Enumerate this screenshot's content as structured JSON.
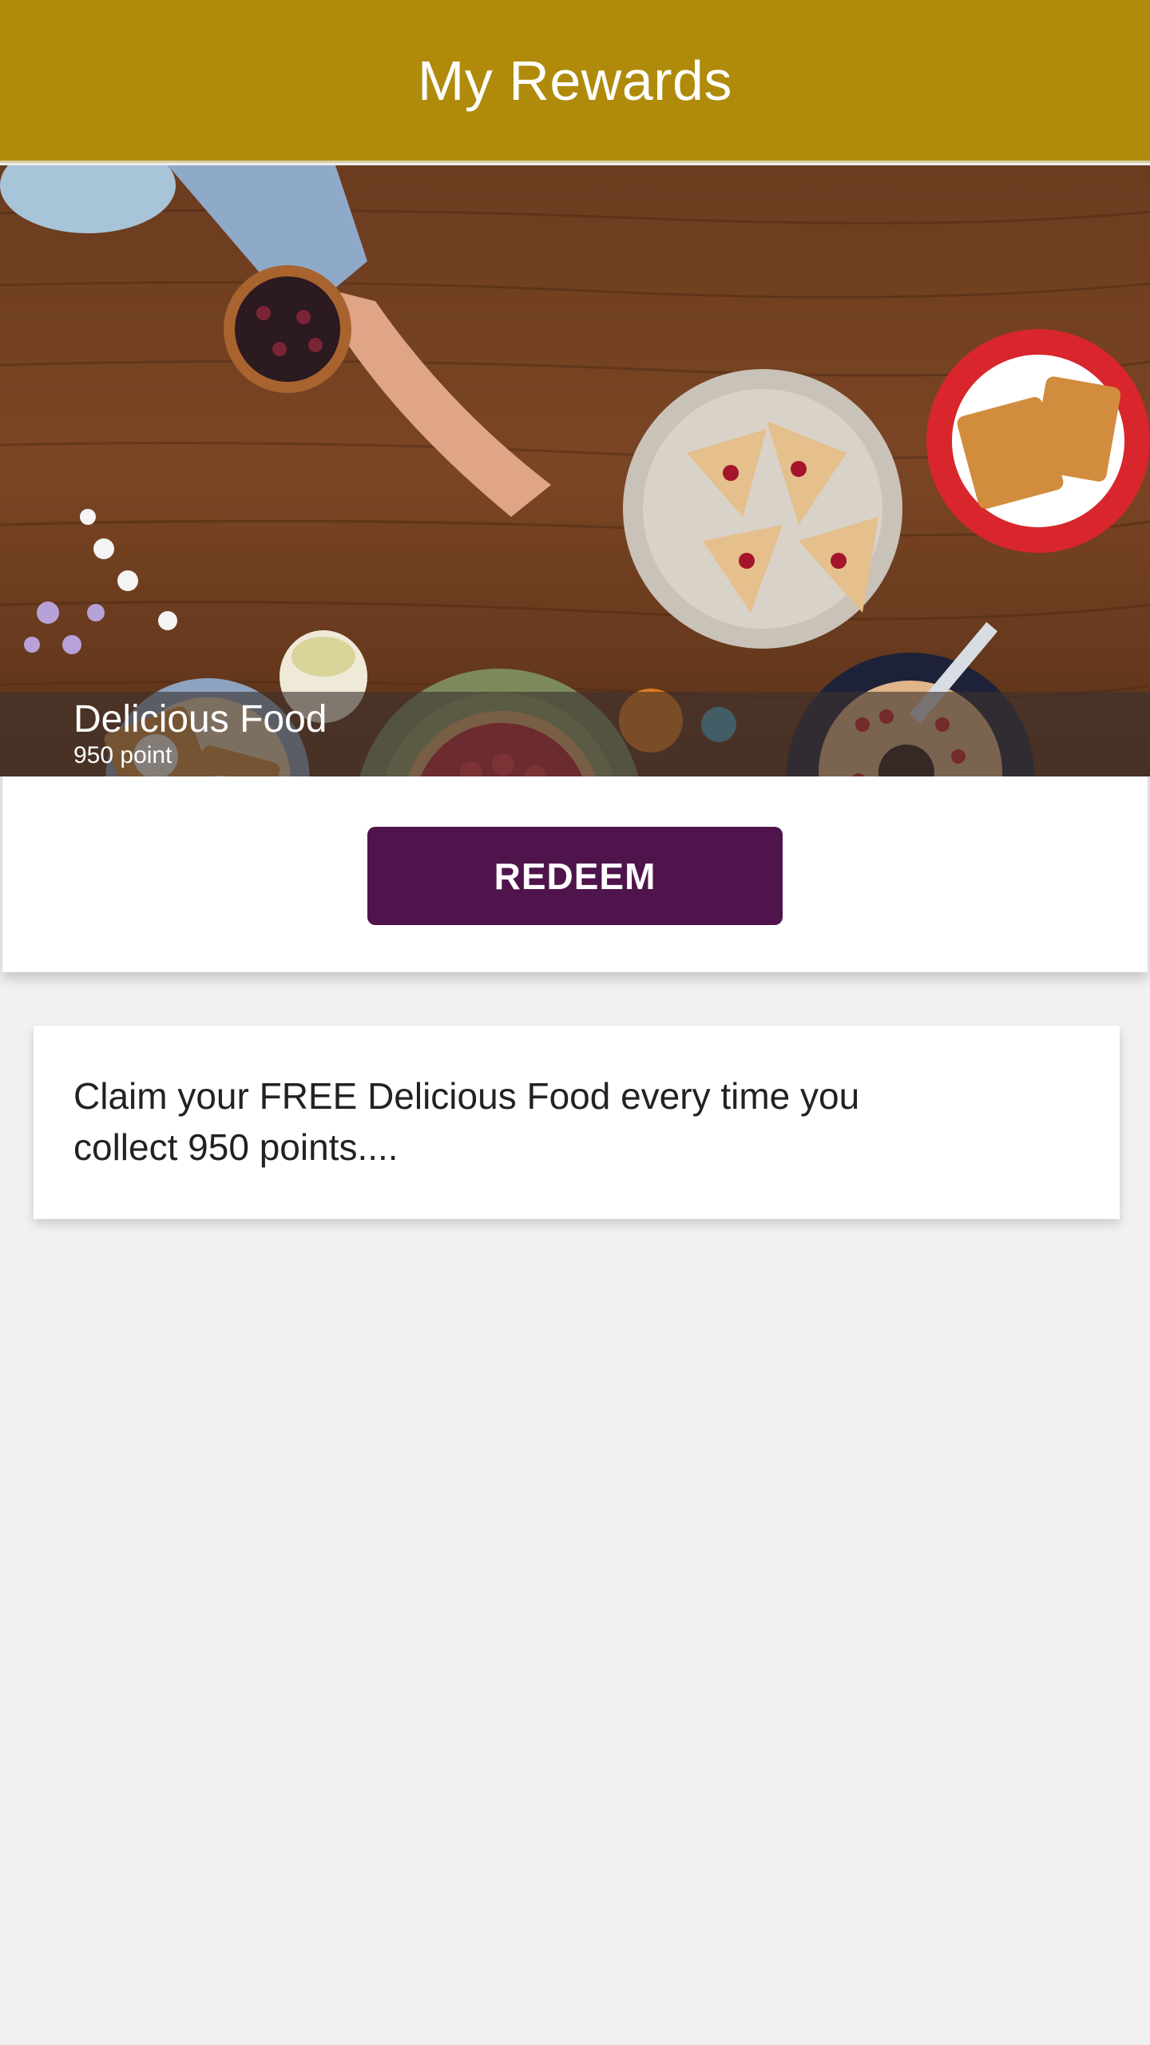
{
  "header": {
    "title": "My Rewards"
  },
  "reward": {
    "name": "Delicious Food",
    "points": "950 point",
    "redeem_label": "REDEEM",
    "description": "Claim your FREE Delicious Food every time you collect 950 points...."
  },
  "colors": {
    "app_bar": "#b08a0b",
    "redeem_button": "#4f144b",
    "background": "#f1f1f1"
  }
}
